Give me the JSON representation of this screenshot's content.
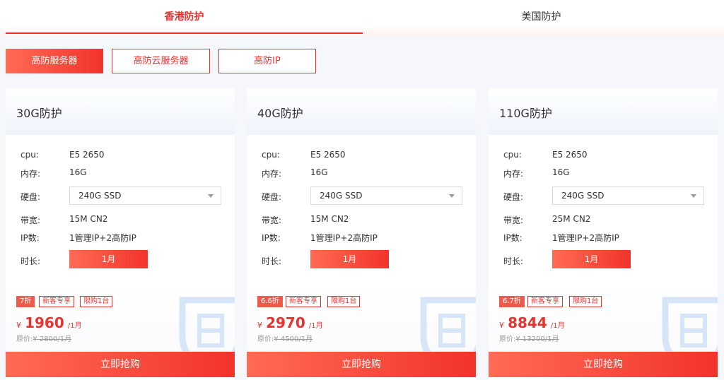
{
  "region_tabs": [
    {
      "label": "香港防护",
      "active": true
    },
    {
      "label": "美国防护",
      "active": false
    }
  ],
  "categories": [
    {
      "label": "高防服务器",
      "active": true
    },
    {
      "label": "高防云服务器",
      "active": false
    },
    {
      "label": "高防IP",
      "active": false
    }
  ],
  "colors": {
    "accent": "#e9322d",
    "accent_light": "#ff6b55",
    "shield": "#cfe3f7"
  },
  "icons": {
    "select_caret": "chevron-down-icon",
    "watermark": "shield-icon"
  },
  "spec_labels": {
    "cpu": "cpu:",
    "memory": "内存:",
    "disk": "硬盘:",
    "bandwidth": "带宽:",
    "ip": "IP数:",
    "duration": "时长:"
  },
  "buy_label": "立即抢购",
  "cards": [
    {
      "title": "30G防护",
      "cpu": "E5 2650",
      "memory": "16G",
      "disk": "240G SSD",
      "bandwidth": "15M CN2",
      "ip": "1管理IP+2高防IP",
      "duration": "1月",
      "discount": "7折",
      "tag_new": "新客专享",
      "tag_limit": "限购1台",
      "currency": "¥",
      "price": "1960",
      "per": "/1月",
      "orig_label": "原价:",
      "orig_price": "¥ 2800/1月"
    },
    {
      "title": "40G防护",
      "cpu": "E5 2650",
      "memory": "16G",
      "disk": "240G SSD",
      "bandwidth": "15M CN2",
      "ip": "1管理IP+2高防IP",
      "duration": "1月",
      "discount": "6.6折",
      "tag_new": "新客专享",
      "tag_limit": "限购1台",
      "currency": "¥",
      "price": "2970",
      "per": "/1月",
      "orig_label": "原价:",
      "orig_price": "¥ 4500/1月"
    },
    {
      "title": "110G防护",
      "cpu": "E5 2650",
      "memory": "16G",
      "disk": "240G SSD",
      "bandwidth": "25M CN2",
      "ip": "1管理IP+2高防IP",
      "duration": "1月",
      "discount": "6.7折",
      "tag_new": "新客专享",
      "tag_limit": "限购1台",
      "currency": "¥",
      "price": "8844",
      "per": "/1月",
      "orig_label": "原价:",
      "orig_price": "¥ 13200/1月"
    }
  ]
}
